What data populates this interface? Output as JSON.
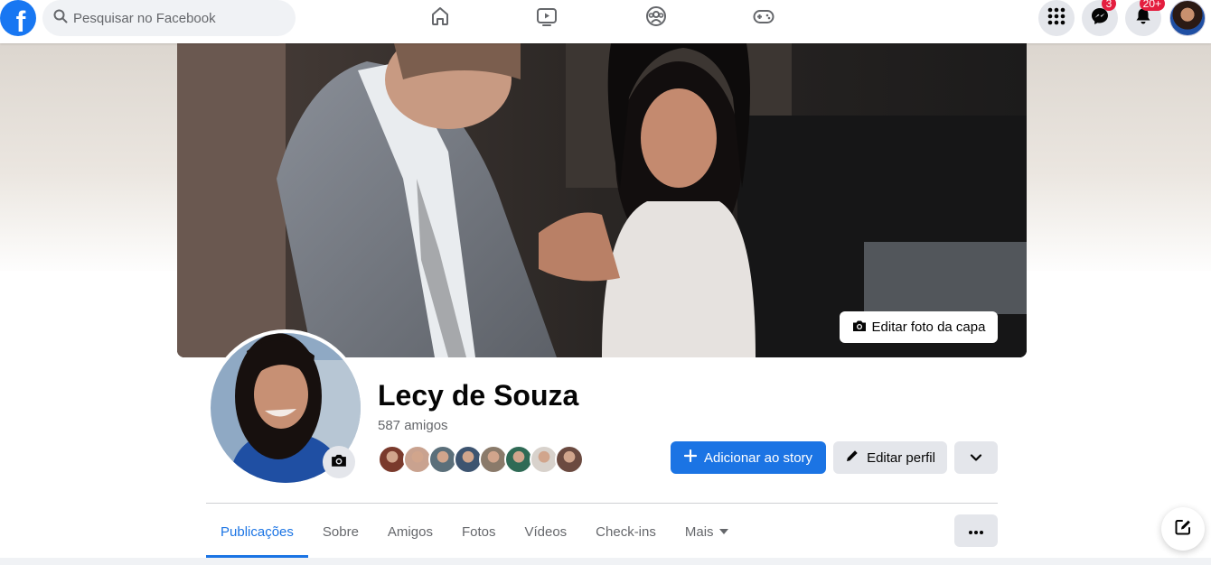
{
  "topbar": {
    "logo_letter": "f",
    "search_placeholder": "Pesquisar no Facebook",
    "nav": [
      {
        "name": "home-icon"
      },
      {
        "name": "watch-icon"
      },
      {
        "name": "groups-icon"
      },
      {
        "name": "gaming-icon"
      }
    ],
    "messenger_badge": "3",
    "notifications_badge": "20+"
  },
  "cover": {
    "edit_label": "Editar foto da capa"
  },
  "profile": {
    "name": "Lecy de Souza",
    "friends_count": "587 amigos",
    "friend_avatar_colors": [
      "#7a3a2c",
      "#c9a28f",
      "#5b6f7a",
      "#3d5470",
      "#8a7a6a",
      "#2f6a55",
      "#d8d2cc",
      "#6b4a40"
    ]
  },
  "actions": {
    "add_story": "Adicionar ao story",
    "edit_profile": "Editar perfil"
  },
  "tabs": [
    {
      "label": "Publicações",
      "active": true
    },
    {
      "label": "Sobre"
    },
    {
      "label": "Amigos"
    },
    {
      "label": "Fotos"
    },
    {
      "label": "Vídeos"
    },
    {
      "label": "Check-ins"
    },
    {
      "label": "Mais"
    }
  ],
  "colors": {
    "brand": "#1877f2",
    "primary_button": "#1b74e4",
    "badge": "#e41e3f"
  }
}
